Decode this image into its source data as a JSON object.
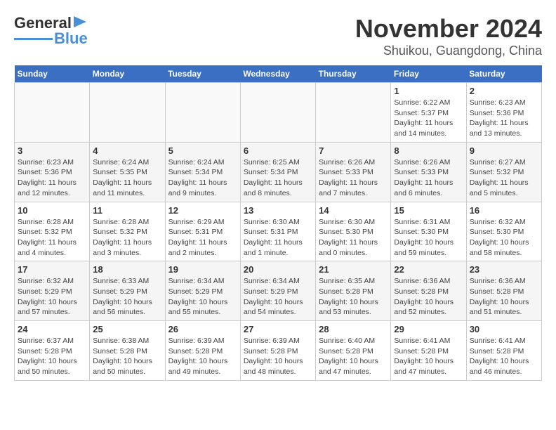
{
  "header": {
    "logo_line1": "General",
    "logo_line2": "Blue",
    "month": "November 2024",
    "location": "Shuikou, Guangdong, China"
  },
  "weekdays": [
    "Sunday",
    "Monday",
    "Tuesday",
    "Wednesday",
    "Thursday",
    "Friday",
    "Saturday"
  ],
  "weeks": [
    [
      {
        "day": "",
        "info": ""
      },
      {
        "day": "",
        "info": ""
      },
      {
        "day": "",
        "info": ""
      },
      {
        "day": "",
        "info": ""
      },
      {
        "day": "",
        "info": ""
      },
      {
        "day": "1",
        "info": "Sunrise: 6:22 AM\nSunset: 5:37 PM\nDaylight: 11 hours and 14 minutes."
      },
      {
        "day": "2",
        "info": "Sunrise: 6:23 AM\nSunset: 5:36 PM\nDaylight: 11 hours and 13 minutes."
      }
    ],
    [
      {
        "day": "3",
        "info": "Sunrise: 6:23 AM\nSunset: 5:36 PM\nDaylight: 11 hours and 12 minutes."
      },
      {
        "day": "4",
        "info": "Sunrise: 6:24 AM\nSunset: 5:35 PM\nDaylight: 11 hours and 11 minutes."
      },
      {
        "day": "5",
        "info": "Sunrise: 6:24 AM\nSunset: 5:34 PM\nDaylight: 11 hours and 9 minutes."
      },
      {
        "day": "6",
        "info": "Sunrise: 6:25 AM\nSunset: 5:34 PM\nDaylight: 11 hours and 8 minutes."
      },
      {
        "day": "7",
        "info": "Sunrise: 6:26 AM\nSunset: 5:33 PM\nDaylight: 11 hours and 7 minutes."
      },
      {
        "day": "8",
        "info": "Sunrise: 6:26 AM\nSunset: 5:33 PM\nDaylight: 11 hours and 6 minutes."
      },
      {
        "day": "9",
        "info": "Sunrise: 6:27 AM\nSunset: 5:32 PM\nDaylight: 11 hours and 5 minutes."
      }
    ],
    [
      {
        "day": "10",
        "info": "Sunrise: 6:28 AM\nSunset: 5:32 PM\nDaylight: 11 hours and 4 minutes."
      },
      {
        "day": "11",
        "info": "Sunrise: 6:28 AM\nSunset: 5:32 PM\nDaylight: 11 hours and 3 minutes."
      },
      {
        "day": "12",
        "info": "Sunrise: 6:29 AM\nSunset: 5:31 PM\nDaylight: 11 hours and 2 minutes."
      },
      {
        "day": "13",
        "info": "Sunrise: 6:30 AM\nSunset: 5:31 PM\nDaylight: 11 hours and 1 minute."
      },
      {
        "day": "14",
        "info": "Sunrise: 6:30 AM\nSunset: 5:30 PM\nDaylight: 11 hours and 0 minutes."
      },
      {
        "day": "15",
        "info": "Sunrise: 6:31 AM\nSunset: 5:30 PM\nDaylight: 10 hours and 59 minutes."
      },
      {
        "day": "16",
        "info": "Sunrise: 6:32 AM\nSunset: 5:30 PM\nDaylight: 10 hours and 58 minutes."
      }
    ],
    [
      {
        "day": "17",
        "info": "Sunrise: 6:32 AM\nSunset: 5:29 PM\nDaylight: 10 hours and 57 minutes."
      },
      {
        "day": "18",
        "info": "Sunrise: 6:33 AM\nSunset: 5:29 PM\nDaylight: 10 hours and 56 minutes."
      },
      {
        "day": "19",
        "info": "Sunrise: 6:34 AM\nSunset: 5:29 PM\nDaylight: 10 hours and 55 minutes."
      },
      {
        "day": "20",
        "info": "Sunrise: 6:34 AM\nSunset: 5:29 PM\nDaylight: 10 hours and 54 minutes."
      },
      {
        "day": "21",
        "info": "Sunrise: 6:35 AM\nSunset: 5:28 PM\nDaylight: 10 hours and 53 minutes."
      },
      {
        "day": "22",
        "info": "Sunrise: 6:36 AM\nSunset: 5:28 PM\nDaylight: 10 hours and 52 minutes."
      },
      {
        "day": "23",
        "info": "Sunrise: 6:36 AM\nSunset: 5:28 PM\nDaylight: 10 hours and 51 minutes."
      }
    ],
    [
      {
        "day": "24",
        "info": "Sunrise: 6:37 AM\nSunset: 5:28 PM\nDaylight: 10 hours and 50 minutes."
      },
      {
        "day": "25",
        "info": "Sunrise: 6:38 AM\nSunset: 5:28 PM\nDaylight: 10 hours and 50 minutes."
      },
      {
        "day": "26",
        "info": "Sunrise: 6:39 AM\nSunset: 5:28 PM\nDaylight: 10 hours and 49 minutes."
      },
      {
        "day": "27",
        "info": "Sunrise: 6:39 AM\nSunset: 5:28 PM\nDaylight: 10 hours and 48 minutes."
      },
      {
        "day": "28",
        "info": "Sunrise: 6:40 AM\nSunset: 5:28 PM\nDaylight: 10 hours and 47 minutes."
      },
      {
        "day": "29",
        "info": "Sunrise: 6:41 AM\nSunset: 5:28 PM\nDaylight: 10 hours and 47 minutes."
      },
      {
        "day": "30",
        "info": "Sunrise: 6:41 AM\nSunset: 5:28 PM\nDaylight: 10 hours and 46 minutes."
      }
    ]
  ]
}
